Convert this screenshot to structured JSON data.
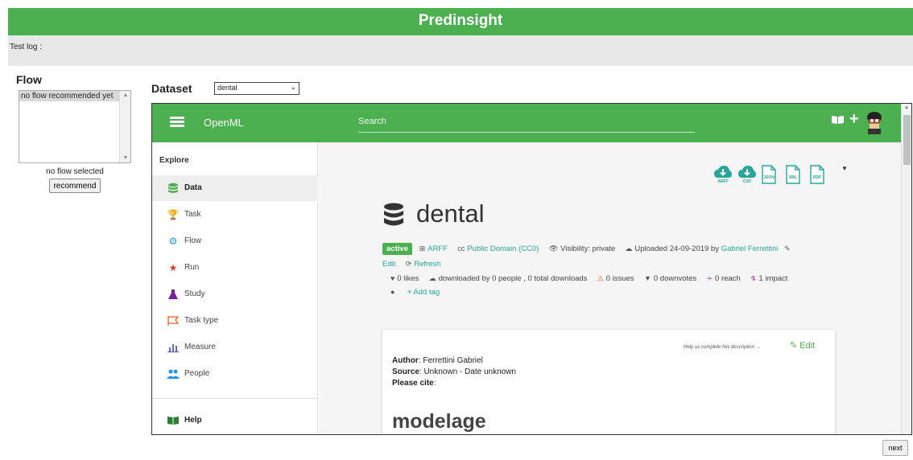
{
  "app": {
    "title": "Predinsight",
    "test_log_label": "Test log :"
  },
  "flow": {
    "heading": "Flow",
    "list_option": "no flow recommended yet",
    "status": "no flow selected",
    "recommend_label": "recommend"
  },
  "dataset": {
    "heading": "Dataset",
    "selected": "dental"
  },
  "openml": {
    "logo": "OpenML",
    "search_placeholder": "Search",
    "sidebar": {
      "heading": "Explore",
      "items": [
        {
          "label": "Data",
          "icon": "database-icon",
          "active": true,
          "color": "#4caf50"
        },
        {
          "label": "Task",
          "icon": "trophy-icon",
          "color": "#ff9800"
        },
        {
          "label": "Flow",
          "icon": "cogs-icon",
          "color": "#2196f3"
        },
        {
          "label": "Run",
          "icon": "star-icon",
          "color": "#e53935"
        },
        {
          "label": "Study",
          "icon": "flask-icon",
          "color": "#7b1fa2"
        },
        {
          "label": "Task type",
          "icon": "flag-icon",
          "color": "#ff5722"
        },
        {
          "label": "Measure",
          "icon": "bar-chart-icon",
          "color": "#5c6bc0"
        },
        {
          "label": "People",
          "icon": "users-icon",
          "color": "#2196f3"
        }
      ],
      "help_label": "Help"
    },
    "downloads": [
      {
        "icon": "cloud-download-icon",
        "caption": "ARFF"
      },
      {
        "icon": "cloud-download-icon",
        "caption": "CSV"
      },
      {
        "icon": "file-icon",
        "caption": "JSON"
      },
      {
        "icon": "file-icon",
        "caption": "XML"
      },
      {
        "icon": "file-icon",
        "caption": "RDF"
      }
    ],
    "dataset_name": "dental",
    "meta": {
      "status_badge": "active",
      "format": "ARFF",
      "license_code": "cc",
      "license": "Public Domain (CC0)",
      "visibility": "Visibility: private",
      "uploaded": "Uploaded 24-09-2019 by",
      "uploader": "Gabriel Ferrettini",
      "edit": "Edit",
      "refresh": "Refresh",
      "likes": "0 likes",
      "downloads_text": "downloaded by 0 people , 0 total downloads",
      "issues": "0 issues",
      "downvotes": "0 downvotes",
      "reach": "0 reach",
      "impact": "1 impact",
      "add_tag": "Add tag"
    },
    "description": {
      "hint": "Help us complete this description →",
      "edit": "Edit",
      "author_label": "Author",
      "author_value": ": Ferrettini Gabriel",
      "source_label": "Source",
      "source_value": ": Unknown - Date unknown",
      "cite_label": "Please cite",
      "cite_value": ":",
      "heading": "modelage"
    },
    "accent_green": "#4caf50",
    "link_teal": "#26a69a"
  },
  "footer": {
    "next_label": "next"
  }
}
